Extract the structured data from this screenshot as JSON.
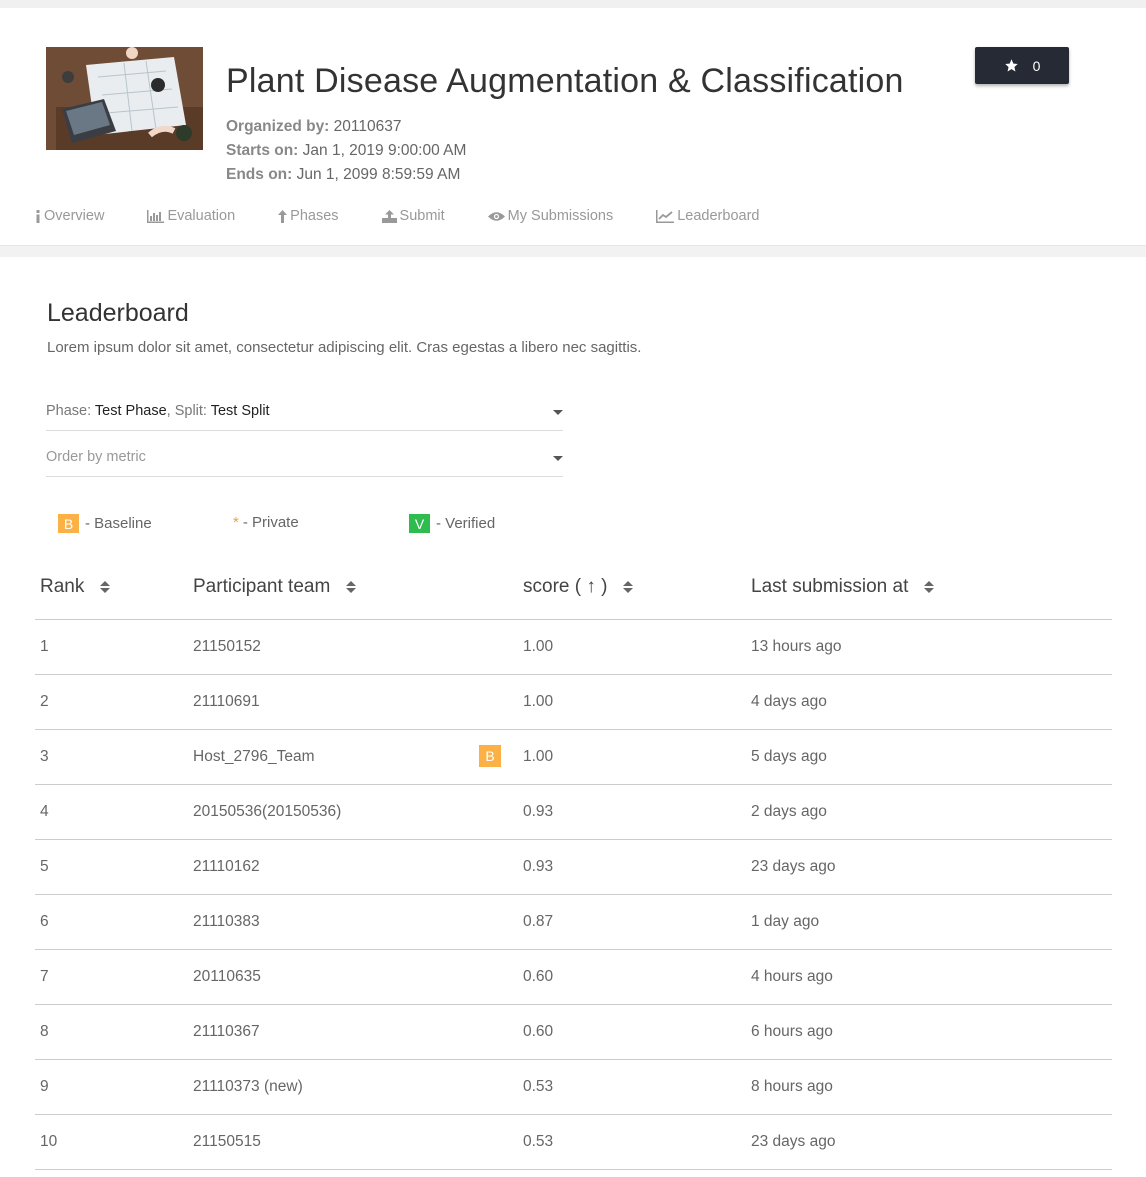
{
  "challenge": {
    "title": "Plant Disease Augmentation & Classification",
    "organized_label": "Organized by:",
    "organized_value": "20110637",
    "starts_label": "Starts on:",
    "starts_value": "Jan 1, 2019 9:00:00 AM",
    "ends_label": "Ends on:",
    "ends_value": "Jun 1, 2099 8:59:59 AM",
    "star_count": "0"
  },
  "tabs": [
    {
      "label": "Overview",
      "icon": "info-icon"
    },
    {
      "label": "Evaluation",
      "icon": "bar-chart-icon"
    },
    {
      "label": "Phases",
      "icon": "upload-arrow-icon"
    },
    {
      "label": "Submit",
      "icon": "upload-icon"
    },
    {
      "label": "My Submissions",
      "icon": "eye-icon"
    },
    {
      "label": "Leaderboard",
      "icon": "line-chart-icon"
    }
  ],
  "leaderboard": {
    "title": "Leaderboard",
    "description": "Lorem ipsum dolor sit amet, consectetur adipiscing elit. Cras egestas a libero nec sagittis.",
    "phase_label": "Phase: ",
    "phase_value": "Test Phase",
    "split_label": ", Split: ",
    "split_value": "Test Split",
    "order_placeholder": "Order by metric",
    "legend": {
      "baseline_badge": "B",
      "baseline_label": "- Baseline",
      "private_mark": "*",
      "private_label": "- Private",
      "verified_badge": "V",
      "verified_label": "- Verified"
    },
    "columns": [
      "Rank",
      "Participant team",
      "score ( ↑ )",
      "Last submission at"
    ],
    "rows": [
      {
        "rank": "1",
        "team": "21150152",
        "score": "1.00",
        "last": "13 hours ago",
        "baseline": false
      },
      {
        "rank": "2",
        "team": "21110691",
        "score": "1.00",
        "last": "4 days ago",
        "baseline": false
      },
      {
        "rank": "3",
        "team": "Host_2796_Team",
        "score": "1.00",
        "last": "5 days ago",
        "baseline": true
      },
      {
        "rank": "4",
        "team": "20150536(20150536)",
        "score": "0.93",
        "last": "2 days ago",
        "baseline": false
      },
      {
        "rank": "5",
        "team": "21110162",
        "score": "0.93",
        "last": "23 days ago",
        "baseline": false
      },
      {
        "rank": "6",
        "team": "21110383",
        "score": "0.87",
        "last": "1 day ago",
        "baseline": false
      },
      {
        "rank": "7",
        "team": "20110635",
        "score": "0.60",
        "last": "4 hours ago",
        "baseline": false
      },
      {
        "rank": "8",
        "team": "21110367",
        "score": "0.60",
        "last": "6 hours ago",
        "baseline": false
      },
      {
        "rank": "9",
        "team": "21110373 (new)",
        "score": "0.53",
        "last": "8 hours ago",
        "baseline": false
      },
      {
        "rank": "10",
        "team": "21150515",
        "score": "0.53",
        "last": "23 days ago",
        "baseline": false
      }
    ]
  },
  "colors": {
    "star_button_bg": "#262a35",
    "baseline_badge": "#fbb146",
    "verified_badge": "#2ebc4f",
    "private_asterisk": "#f0a040"
  }
}
